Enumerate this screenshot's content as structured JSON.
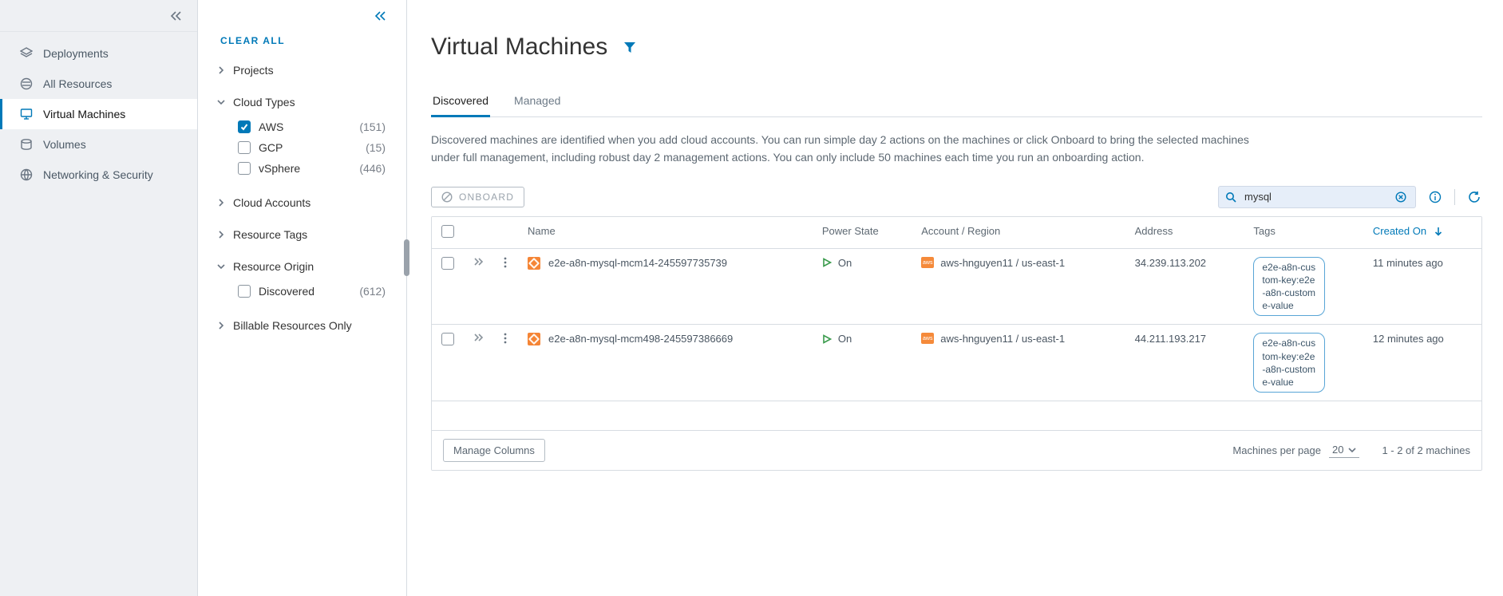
{
  "nav": {
    "items": [
      {
        "label": "Deployments"
      },
      {
        "label": "All Resources"
      },
      {
        "label": "Virtual Machines"
      },
      {
        "label": "Volumes"
      },
      {
        "label": "Networking & Security"
      }
    ]
  },
  "filters": {
    "clear_all": "CLEAR ALL",
    "groups": {
      "projects": {
        "label": "Projects"
      },
      "cloud_types": {
        "label": "Cloud Types",
        "options": [
          {
            "label": "AWS",
            "count": "(151)",
            "checked": true
          },
          {
            "label": "GCP",
            "count": "(15)",
            "checked": false
          },
          {
            "label": "vSphere",
            "count": "(446)",
            "checked": false
          }
        ]
      },
      "cloud_accounts": {
        "label": "Cloud Accounts"
      },
      "resource_tags": {
        "label": "Resource Tags"
      },
      "resource_origin": {
        "label": "Resource Origin",
        "options": [
          {
            "label": "Discovered",
            "count": "(612)",
            "checked": false
          }
        ]
      },
      "billable": {
        "label": "Billable Resources Only"
      }
    }
  },
  "page": {
    "title": "Virtual Machines",
    "tabs": [
      {
        "label": "Discovered",
        "active": true
      },
      {
        "label": "Managed",
        "active": false
      }
    ],
    "description": "Discovered machines are identified when you add cloud accounts. You can run simple day 2 actions on the machines or click Onboard to bring the selected machines under full management, including robust day 2 management actions. You can only include 50 machines each time you run an onboarding action.",
    "onboard_label": "ONBOARD",
    "search_value": "mysql"
  },
  "table": {
    "headers": {
      "name": "Name",
      "power": "Power State",
      "account": "Account / Region",
      "address": "Address",
      "tags": "Tags",
      "created": "Created On"
    },
    "rows": [
      {
        "name": "e2e-a8n-mysql-mcm14-245597735739",
        "power": "On",
        "account": "aws-hnguyen11 / us-east-1",
        "address": "34.239.113.202",
        "tag": "e2e-a8n-custom-key:e2e-a8n-custome-value",
        "created": "11 minutes ago"
      },
      {
        "name": "e2e-a8n-mysql-mcm498-245597386669",
        "power": "On",
        "account": "aws-hnguyen11 / us-east-1",
        "address": "44.211.193.217",
        "tag": "e2e-a8n-custom-key:e2e-a8n-custome-value",
        "created": "12 minutes ago"
      }
    ]
  },
  "footer": {
    "manage_columns": "Manage Columns",
    "per_page_label": "Machines per page",
    "per_page_value": "20",
    "range": "1 - 2 of 2 machines"
  }
}
